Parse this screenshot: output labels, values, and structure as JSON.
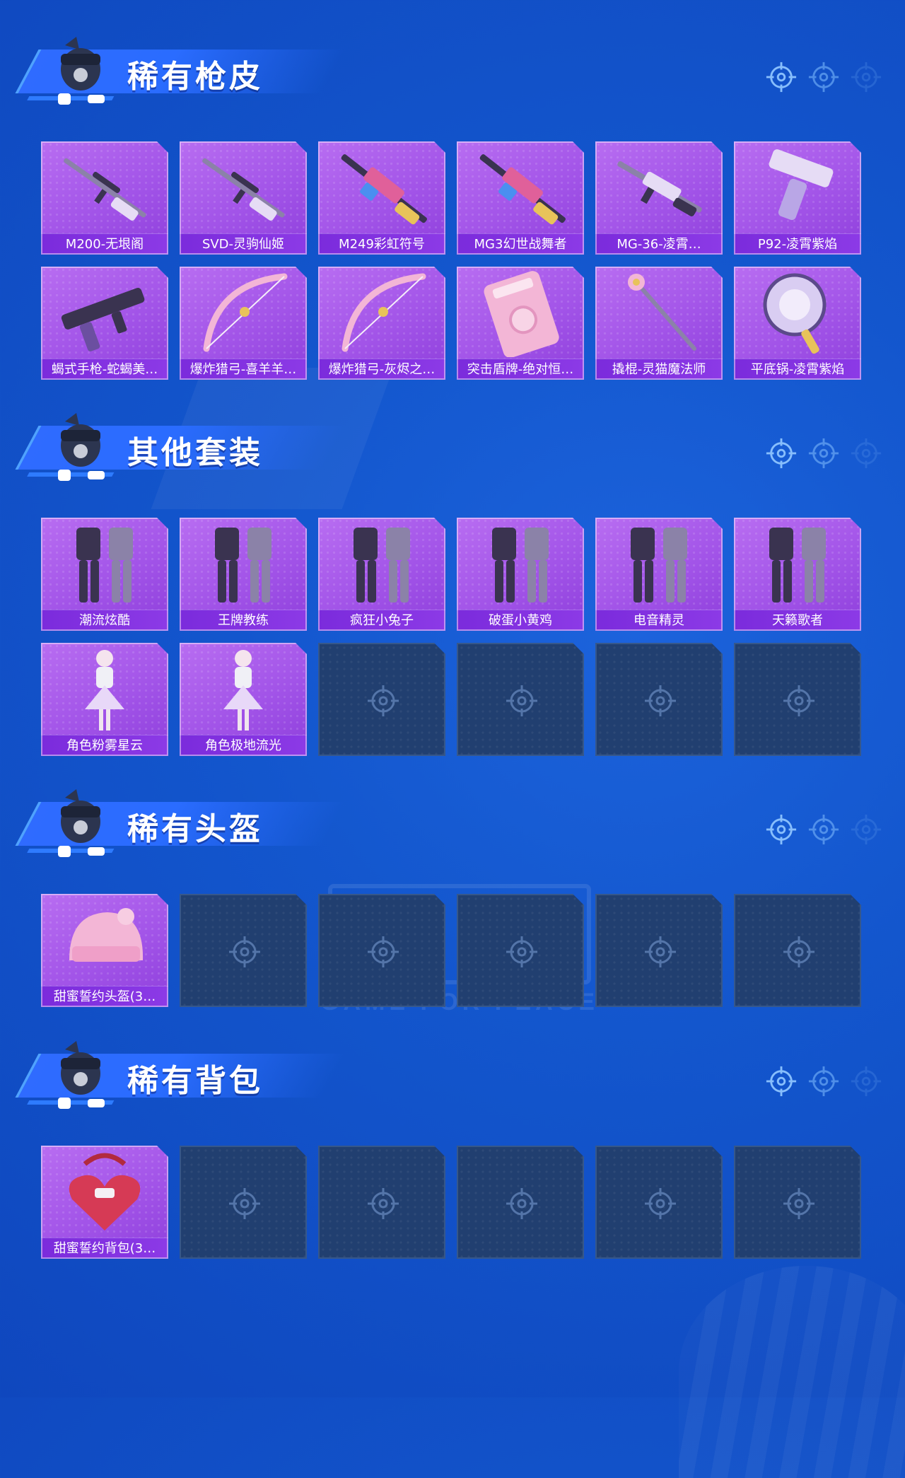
{
  "sections": [
    {
      "title": "稀有枪皮",
      "rows": [
        [
          {
            "label": "M200-无垠阁",
            "icon": "sniper-rifle-icon"
          },
          {
            "label": "SVD-灵驹仙姬",
            "icon": "sniper-rifle-icon"
          },
          {
            "label": "M249彩虹符号",
            "icon": "machine-gun-icon"
          },
          {
            "label": "MG3幻世战舞者",
            "icon": "machine-gun-icon"
          },
          {
            "label": "MG-36-凌霄…",
            "icon": "assault-rifle-icon"
          },
          {
            "label": "P92-凌霄紫焰",
            "icon": "pistol-icon"
          }
        ],
        [
          {
            "label": "蝎式手枪-蛇蝎美…",
            "icon": "smg-icon"
          },
          {
            "label": "爆炸猎弓-喜羊羊…",
            "icon": "bow-icon"
          },
          {
            "label": "爆炸猎弓-灰烬之…",
            "icon": "bow-icon"
          },
          {
            "label": "突击盾牌-绝对恒…",
            "icon": "shield-icon"
          },
          {
            "label": "撬棍-灵猫魔法师",
            "icon": "staff-icon"
          },
          {
            "label": "平底锅-凌霄紫焰",
            "icon": "pan-icon"
          }
        ]
      ],
      "empty_count": [
        0,
        0
      ]
    },
    {
      "title": "其他套装",
      "rows": [
        [
          {
            "label": "潮流炫酷",
            "icon": "outfit-icon"
          },
          {
            "label": "王牌教练",
            "icon": "outfit-icon"
          },
          {
            "label": "疯狂小兔子",
            "icon": "outfit-icon"
          },
          {
            "label": "破蛋小黄鸡",
            "icon": "outfit-icon"
          },
          {
            "label": "电音精灵",
            "icon": "outfit-icon"
          },
          {
            "label": "天籁歌者",
            "icon": "outfit-icon"
          }
        ],
        [
          {
            "label": "角色粉雾星云",
            "icon": "character-icon"
          },
          {
            "label": "角色极地流光",
            "icon": "character-icon"
          }
        ]
      ],
      "empty_count": [
        0,
        4
      ]
    },
    {
      "title": "稀有头盔",
      "rows": [
        [
          {
            "label": "甜蜜誓约头盔(3…",
            "icon": "helmet-icon"
          }
        ]
      ],
      "empty_count": [
        5
      ]
    },
    {
      "title": "稀有背包",
      "rows": [
        [
          {
            "label": "甜蜜誓约背包(3…",
            "icon": "backpack-icon"
          }
        ]
      ],
      "empty_count": [
        5
      ]
    }
  ],
  "watermark_text": "GAME FOR PEACE",
  "colors": {
    "background": "#1356cd",
    "card_purple": "#a254e8",
    "label_purple": "#7b2bdc",
    "empty_slot": "#213f70",
    "banner_blue": "#2f6bff"
  }
}
